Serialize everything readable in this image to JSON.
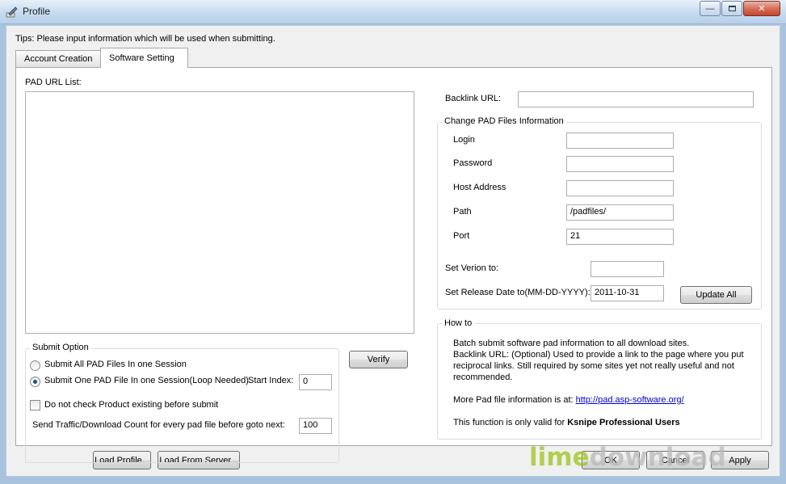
{
  "window": {
    "title": "Profile",
    "minimize_icon": "minimize-icon",
    "maximize_icon": "maximize-icon",
    "close_icon": "close-icon"
  },
  "tips": "Tips: Please input information which will be used when submitting.",
  "tabs": [
    {
      "label": "Account Creation",
      "active": false
    },
    {
      "label": "Software Setting",
      "active": true
    }
  ],
  "pad_url_list": {
    "label": "PAD URL List:",
    "items": []
  },
  "backlink": {
    "label": "Backlink URL:",
    "value": ""
  },
  "change_pad": {
    "title": "Change PAD Files Information",
    "login": {
      "label": "Login",
      "value": ""
    },
    "password": {
      "label": "Password",
      "value": ""
    },
    "host": {
      "label": "Host Address",
      "value": ""
    },
    "path": {
      "label": "Path",
      "value": "/padfiles/"
    },
    "port": {
      "label": "Port",
      "value": "21"
    },
    "version": {
      "label": "Set Verion to:",
      "value": ""
    },
    "release_date": {
      "label": "Set Release Date to(MM-DD-YYYY):",
      "value": "2011-10-31"
    },
    "update_all": "Update All"
  },
  "submit_option": {
    "title": "Submit Option",
    "all_label": "Submit All PAD Files In one Session",
    "one_label": "Submit One PAD File In one Session(Loop Needed).",
    "selected": "one",
    "start_index_label": "Start Index:",
    "start_index": "0",
    "no_check_label": "Do not check Product existing before submit",
    "no_check": false,
    "traffic_label": "Send Traffic/Download Count for every pad file before goto next:",
    "traffic_value": "100"
  },
  "verify": "Verify",
  "howto": {
    "title": "How to",
    "line1": "Batch submit software pad information to all download sites.",
    "line2": "Backlink URL: (Optional) Used to provide a link to the page where you put",
    "line3": "reciprocal links. Still required by some sites yet not really useful and not",
    "line4": "recommended.",
    "more_prefix": "More Pad file information is at: ",
    "more_link": "http://pad.asp-software.org/",
    "valid_prefix": "This function is only valid for ",
    "valid_bold": "Ksnipe Professional Users"
  },
  "bottom": {
    "load_profile": "Load Profile...",
    "load_server": "Load From Server...",
    "ok": "OK",
    "cancel": "Cancel",
    "apply": "Apply"
  },
  "watermark": {
    "lime": "lime",
    "download": "download",
    "lime_color": "#9cc41a",
    "download_color": "#b9b9b9"
  }
}
